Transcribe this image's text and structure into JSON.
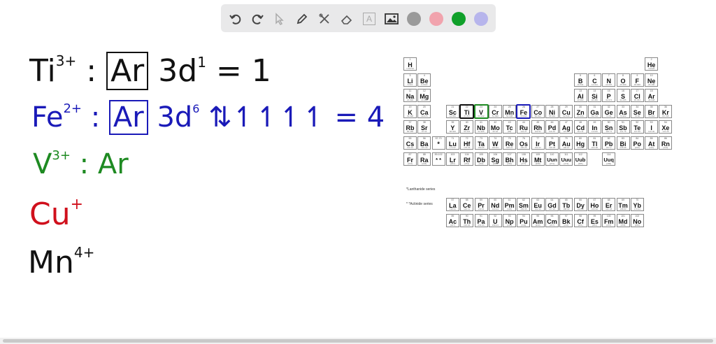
{
  "toolbar": {
    "tools": [
      "undo-icon",
      "redo-icon",
      "select-icon",
      "pen-icon",
      "tools-icon",
      "eraser-icon",
      "text-icon",
      "image-icon"
    ],
    "text_tool_glyph": "A",
    "colors": [
      "#9a9a9a",
      "#f1a3ad",
      "#10a02a",
      "#b7b5ec"
    ]
  },
  "notes": [
    {
      "ion_symbol": "Ti",
      "ion_charge": "3+",
      "sep": ":",
      "core": "Ar",
      "config": "3d",
      "config_sup": "1",
      "rest": "= 1",
      "color": "#111111"
    },
    {
      "ion_symbol": "Fe",
      "ion_charge": "2+",
      "sep": ":",
      "core": "Ar",
      "config": "3d",
      "config_sup": "6",
      "rest": "⇅↿↿↿↿ = 4",
      "color": "#1a1ab8"
    },
    {
      "ion_symbol": "V",
      "ion_charge": "3+",
      "sep": ":",
      "core": "Ar",
      "color": "#1e8a22"
    },
    {
      "ion_symbol": "Cu",
      "ion_charge": "+",
      "color": "#d0101c"
    },
    {
      "ion_symbol": "Mn",
      "ion_charge": "4+",
      "color": "#111111"
    }
  ],
  "periodic_table": {
    "lanthanide_label": "*Lanthanide series",
    "actinide_label": "* *Actinide series",
    "elements": [
      {
        "n": "1",
        "s": "H",
        "w": "1.00794",
        "c": 0,
        "r": 0
      },
      {
        "n": "2",
        "s": "He",
        "w": "4.0026",
        "c": 17,
        "r": 0
      },
      {
        "n": "3",
        "s": "Li",
        "w": "6.941",
        "c": 0,
        "r": 1
      },
      {
        "n": "4",
        "s": "Be",
        "w": "9.0122",
        "c": 1,
        "r": 1
      },
      {
        "n": "5",
        "s": "B",
        "w": "10.811",
        "c": 12,
        "r": 1
      },
      {
        "n": "6",
        "s": "C",
        "w": "12.011",
        "c": 13,
        "r": 1
      },
      {
        "n": "7",
        "s": "N",
        "w": "14.007",
        "c": 14,
        "r": 1
      },
      {
        "n": "8",
        "s": "O",
        "w": "15.999",
        "c": 15,
        "r": 1
      },
      {
        "n": "9",
        "s": "F",
        "w": "18.998",
        "c": 16,
        "r": 1
      },
      {
        "n": "10",
        "s": "Ne",
        "w": "20.180",
        "c": 17,
        "r": 1
      },
      {
        "n": "11",
        "s": "Na",
        "w": "22.990",
        "c": 0,
        "r": 2
      },
      {
        "n": "12",
        "s": "Mg",
        "w": "24.305",
        "c": 1,
        "r": 2
      },
      {
        "n": "13",
        "s": "Al",
        "w": "26.982",
        "c": 12,
        "r": 2
      },
      {
        "n": "14",
        "s": "Si",
        "w": "28.086",
        "c": 13,
        "r": 2
      },
      {
        "n": "15",
        "s": "P",
        "w": "30.974",
        "c": 14,
        "r": 2
      },
      {
        "n": "16",
        "s": "S",
        "w": "32.065",
        "c": 15,
        "r": 2
      },
      {
        "n": "17",
        "s": "Cl",
        "w": "35.453",
        "c": 16,
        "r": 2
      },
      {
        "n": "18",
        "s": "Ar",
        "w": "39.948",
        "c": 17,
        "r": 2
      },
      {
        "n": "19",
        "s": "K",
        "w": "39.098",
        "c": 0,
        "r": 3
      },
      {
        "n": "20",
        "s": "Ca",
        "w": "40.078",
        "c": 1,
        "r": 3
      },
      {
        "n": "21",
        "s": "Sc",
        "w": "44.956",
        "c": 3,
        "r": 3
      },
      {
        "n": "22",
        "s": "Ti",
        "w": "47.867",
        "c": 4,
        "r": 3
      },
      {
        "n": "23",
        "s": "V",
        "w": "50.942",
        "c": 5,
        "r": 3
      },
      {
        "n": "24",
        "s": "Cr",
        "w": "51.996",
        "c": 6,
        "r": 3
      },
      {
        "n": "25",
        "s": "Mn",
        "w": "54.938",
        "c": 7,
        "r": 3
      },
      {
        "n": "26",
        "s": "Fe",
        "w": "55.845",
        "c": 8,
        "r": 3
      },
      {
        "n": "27",
        "s": "Co",
        "w": "58.933",
        "c": 9,
        "r": 3
      },
      {
        "n": "28",
        "s": "Ni",
        "w": "58.693",
        "c": 10,
        "r": 3
      },
      {
        "n": "29",
        "s": "Cu",
        "w": "63.546",
        "c": 11,
        "r": 3
      },
      {
        "n": "30",
        "s": "Zn",
        "w": "65.409",
        "c": 12,
        "r": 3
      },
      {
        "n": "31",
        "s": "Ga",
        "w": "69.723",
        "c": 13,
        "r": 3
      },
      {
        "n": "32",
        "s": "Ge",
        "w": "72.64",
        "c": 14,
        "r": 3
      },
      {
        "n": "33",
        "s": "As",
        "w": "74.922",
        "c": 15,
        "r": 3
      },
      {
        "n": "34",
        "s": "Se",
        "w": "78.96",
        "c": 16,
        "r": 3
      },
      {
        "n": "35",
        "s": "Br",
        "w": "79.904",
        "c": 17,
        "r": 3
      },
      {
        "n": "36",
        "s": "Kr",
        "w": "83.798",
        "c": 18,
        "r": 3
      },
      {
        "n": "37",
        "s": "Rb",
        "w": "85.468",
        "c": 0,
        "r": 4
      },
      {
        "n": "38",
        "s": "Sr",
        "w": "87.62",
        "c": 1,
        "r": 4
      },
      {
        "n": "39",
        "s": "Y",
        "w": "88.906",
        "c": 3,
        "r": 4
      },
      {
        "n": "40",
        "s": "Zr",
        "w": "91.224",
        "c": 4,
        "r": 4
      },
      {
        "n": "41",
        "s": "Nb",
        "w": "92.906",
        "c": 5,
        "r": 4
      },
      {
        "n": "42",
        "s": "Mo",
        "w": "95.94",
        "c": 6,
        "r": 4
      },
      {
        "n": "43",
        "s": "Tc",
        "w": "[98]",
        "c": 7,
        "r": 4
      },
      {
        "n": "44",
        "s": "Ru",
        "w": "101.07",
        "c": 8,
        "r": 4
      },
      {
        "n": "45",
        "s": "Rh",
        "w": "102.91",
        "c": 9,
        "r": 4
      },
      {
        "n": "46",
        "s": "Pd",
        "w": "106.42",
        "c": 10,
        "r": 4
      },
      {
        "n": "47",
        "s": "Ag",
        "w": "107.87",
        "c": 11,
        "r": 4
      },
      {
        "n": "48",
        "s": "Cd",
        "w": "112.41",
        "c": 12,
        "r": 4
      },
      {
        "n": "49",
        "s": "In",
        "w": "114.82",
        "c": 13,
        "r": 4
      },
      {
        "n": "50",
        "s": "Sn",
        "w": "118.71",
        "c": 14,
        "r": 4
      },
      {
        "n": "51",
        "s": "Sb",
        "w": "121.76",
        "c": 15,
        "r": 4
      },
      {
        "n": "52",
        "s": "Te",
        "w": "127.60",
        "c": 16,
        "r": 4
      },
      {
        "n": "53",
        "s": "I",
        "w": "126.90",
        "c": 17,
        "r": 4
      },
      {
        "n": "54",
        "s": "Xe",
        "w": "131.29",
        "c": 18,
        "r": 4
      },
      {
        "n": "55",
        "s": "Cs",
        "w": "132.91",
        "c": 0,
        "r": 5
      },
      {
        "n": "56",
        "s": "Ba",
        "w": "137.33",
        "c": 1,
        "r": 5
      },
      {
        "n": "57-70",
        "s": "*",
        "w": "",
        "c": 2,
        "r": 5
      },
      {
        "n": "71",
        "s": "Lu",
        "w": "174.97",
        "c": 3,
        "r": 5
      },
      {
        "n": "72",
        "s": "Hf",
        "w": "178.49",
        "c": 4,
        "r": 5
      },
      {
        "n": "73",
        "s": "Ta",
        "w": "180.95",
        "c": 5,
        "r": 5
      },
      {
        "n": "74",
        "s": "W",
        "w": "183.84",
        "c": 6,
        "r": 5
      },
      {
        "n": "75",
        "s": "Re",
        "w": "186.21",
        "c": 7,
        "r": 5
      },
      {
        "n": "76",
        "s": "Os",
        "w": "190.23",
        "c": 8,
        "r": 5
      },
      {
        "n": "77",
        "s": "Ir",
        "w": "192.22",
        "c": 9,
        "r": 5
      },
      {
        "n": "78",
        "s": "Pt",
        "w": "195.08",
        "c": 10,
        "r": 5
      },
      {
        "n": "79",
        "s": "Au",
        "w": "196.97",
        "c": 11,
        "r": 5
      },
      {
        "n": "80",
        "s": "Hg",
        "w": "200.59",
        "c": 12,
        "r": 5
      },
      {
        "n": "81",
        "s": "Tl",
        "w": "204.38",
        "c": 13,
        "r": 5
      },
      {
        "n": "82",
        "s": "Pb",
        "w": "207.2",
        "c": 14,
        "r": 5
      },
      {
        "n": "83",
        "s": "Bi",
        "w": "208.98",
        "c": 15,
        "r": 5
      },
      {
        "n": "84",
        "s": "Po",
        "w": "[209]",
        "c": 16,
        "r": 5
      },
      {
        "n": "85",
        "s": "At",
        "w": "[210]",
        "c": 17,
        "r": 5
      },
      {
        "n": "86",
        "s": "Rn",
        "w": "[222]",
        "c": 18,
        "r": 5
      },
      {
        "n": "87",
        "s": "Fr",
        "w": "[223]",
        "c": 0,
        "r": 6
      },
      {
        "n": "88",
        "s": "Ra",
        "w": "[226]",
        "c": 1,
        "r": 6
      },
      {
        "n": "89-102",
        "s": "* *",
        "w": "",
        "c": 2,
        "r": 6
      },
      {
        "n": "103",
        "s": "Lr",
        "w": "[262]",
        "c": 3,
        "r": 6
      },
      {
        "n": "104",
        "s": "Rf",
        "w": "[261]",
        "c": 4,
        "r": 6
      },
      {
        "n": "105",
        "s": "Db",
        "w": "[262]",
        "c": 5,
        "r": 6
      },
      {
        "n": "106",
        "s": "Sg",
        "w": "[266]",
        "c": 6,
        "r": 6
      },
      {
        "n": "107",
        "s": "Bh",
        "w": "[264]",
        "c": 7,
        "r": 6
      },
      {
        "n": "108",
        "s": "Hs",
        "w": "[277]",
        "c": 8,
        "r": 6
      },
      {
        "n": "109",
        "s": "Mt",
        "w": "[268]",
        "c": 9,
        "r": 6
      },
      {
        "n": "110",
        "s": "Uun",
        "w": "[271]",
        "c": 10,
        "r": 6
      },
      {
        "n": "111",
        "s": "Uuu",
        "w": "[272]",
        "c": 11,
        "r": 6
      },
      {
        "n": "112",
        "s": "Uub",
        "w": "[285]",
        "c": 12,
        "r": 6
      },
      {
        "n": "114",
        "s": "Uuq",
        "w": "[289]",
        "c": 14,
        "r": 6
      },
      {
        "n": "57",
        "s": "La",
        "w": "138.91",
        "c": 3,
        "r": 8.9
      },
      {
        "n": "58",
        "s": "Ce",
        "w": "140.12",
        "c": 4,
        "r": 8.9
      },
      {
        "n": "59",
        "s": "Pr",
        "w": "140.91",
        "c": 5,
        "r": 8.9
      },
      {
        "n": "60",
        "s": "Nd",
        "w": "144.24",
        "c": 6,
        "r": 8.9
      },
      {
        "n": "61",
        "s": "Pm",
        "w": "[145]",
        "c": 7,
        "r": 8.9
      },
      {
        "n": "62",
        "s": "Sm",
        "w": "150.36",
        "c": 8,
        "r": 8.9
      },
      {
        "n": "63",
        "s": "Eu",
        "w": "151.96",
        "c": 9,
        "r": 8.9
      },
      {
        "n": "64",
        "s": "Gd",
        "w": "157.25",
        "c": 10,
        "r": 8.9
      },
      {
        "n": "65",
        "s": "Tb",
        "w": "158.93",
        "c": 11,
        "r": 8.9
      },
      {
        "n": "66",
        "s": "Dy",
        "w": "162.50",
        "c": 12,
        "r": 8.9
      },
      {
        "n": "67",
        "s": "Ho",
        "w": "164.93",
        "c": 13,
        "r": 8.9
      },
      {
        "n": "68",
        "s": "Er",
        "w": "167.26",
        "c": 14,
        "r": 8.9
      },
      {
        "n": "69",
        "s": "Tm",
        "w": "168.93",
        "c": 15,
        "r": 8.9
      },
      {
        "n": "70",
        "s": "Yb",
        "w": "173.04",
        "c": 16,
        "r": 8.9
      },
      {
        "n": "89",
        "s": "Ac",
        "w": "[227]",
        "c": 3,
        "r": 9.9
      },
      {
        "n": "90",
        "s": "Th",
        "w": "232.04",
        "c": 4,
        "r": 9.9
      },
      {
        "n": "91",
        "s": "Pa",
        "w": "231.04",
        "c": 5,
        "r": 9.9
      },
      {
        "n": "92",
        "s": "U",
        "w": "238.03",
        "c": 6,
        "r": 9.9
      },
      {
        "n": "93",
        "s": "Np",
        "w": "[237]",
        "c": 7,
        "r": 9.9
      },
      {
        "n": "94",
        "s": "Pu",
        "w": "[244]",
        "c": 8,
        "r": 9.9
      },
      {
        "n": "95",
        "s": "Am",
        "w": "[243]",
        "c": 9,
        "r": 9.9
      },
      {
        "n": "96",
        "s": "Cm",
        "w": "[247]",
        "c": 10,
        "r": 9.9
      },
      {
        "n": "97",
        "s": "Bk",
        "w": "[247]",
        "c": 11,
        "r": 9.9
      },
      {
        "n": "98",
        "s": "Cf",
        "w": "[251]",
        "c": 12,
        "r": 9.9
      },
      {
        "n": "99",
        "s": "Es",
        "w": "[252]",
        "c": 13,
        "r": 9.9
      },
      {
        "n": "100",
        "s": "Fm",
        "w": "[257]",
        "c": 14,
        "r": 9.9
      },
      {
        "n": "101",
        "s": "Md",
        "w": "[258]",
        "c": 15,
        "r": 9.9
      },
      {
        "n": "102",
        "s": "No",
        "w": "[259]",
        "c": 16,
        "r": 9.9
      }
    ],
    "highlights": [
      {
        "symbol": "Ti",
        "color": "#111111"
      },
      {
        "symbol": "V",
        "color": "#1e8a22"
      },
      {
        "symbol": "Fe",
        "color": "#1a1ab8"
      }
    ]
  }
}
